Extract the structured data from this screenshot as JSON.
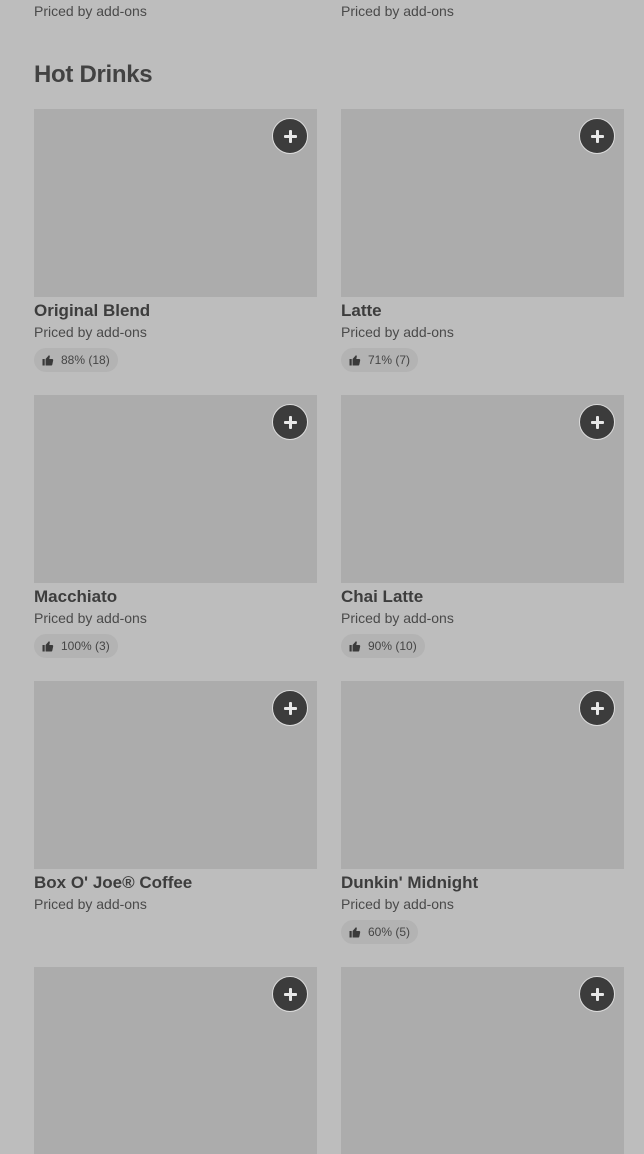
{
  "prev_section": {
    "prices": [
      "Priced by add-ons",
      "Priced by add-ons"
    ]
  },
  "section": {
    "title": "Hot Drinks"
  },
  "items": [
    {
      "name": "Original Blend",
      "price": "Priced by add-ons",
      "rating": "88% (18)"
    },
    {
      "name": "Latte",
      "price": "Priced by add-ons",
      "rating": "71% (7)"
    },
    {
      "name": "Macchiato",
      "price": "Priced by add-ons",
      "rating": "100% (3)"
    },
    {
      "name": "Chai Latte",
      "price": "Priced by add-ons",
      "rating": "90% (10)"
    },
    {
      "name": "Box O' Joe® Coffee",
      "price": "Priced by add-ons",
      "rating": null
    },
    {
      "name": "Dunkin' Midnight",
      "price": "Priced by add-ons",
      "rating": "60% (5)"
    },
    {
      "name": "",
      "price": "",
      "rating": null
    },
    {
      "name": "",
      "price": "",
      "rating": null
    }
  ],
  "icons": {
    "add": "plus-icon",
    "rating": "thumbs-up-icon"
  },
  "colors": {
    "background": "#bdbdbd",
    "image_placeholder": "#acacac",
    "add_button": "#3c3c3c",
    "rating_pill": "#b3b3b3"
  }
}
